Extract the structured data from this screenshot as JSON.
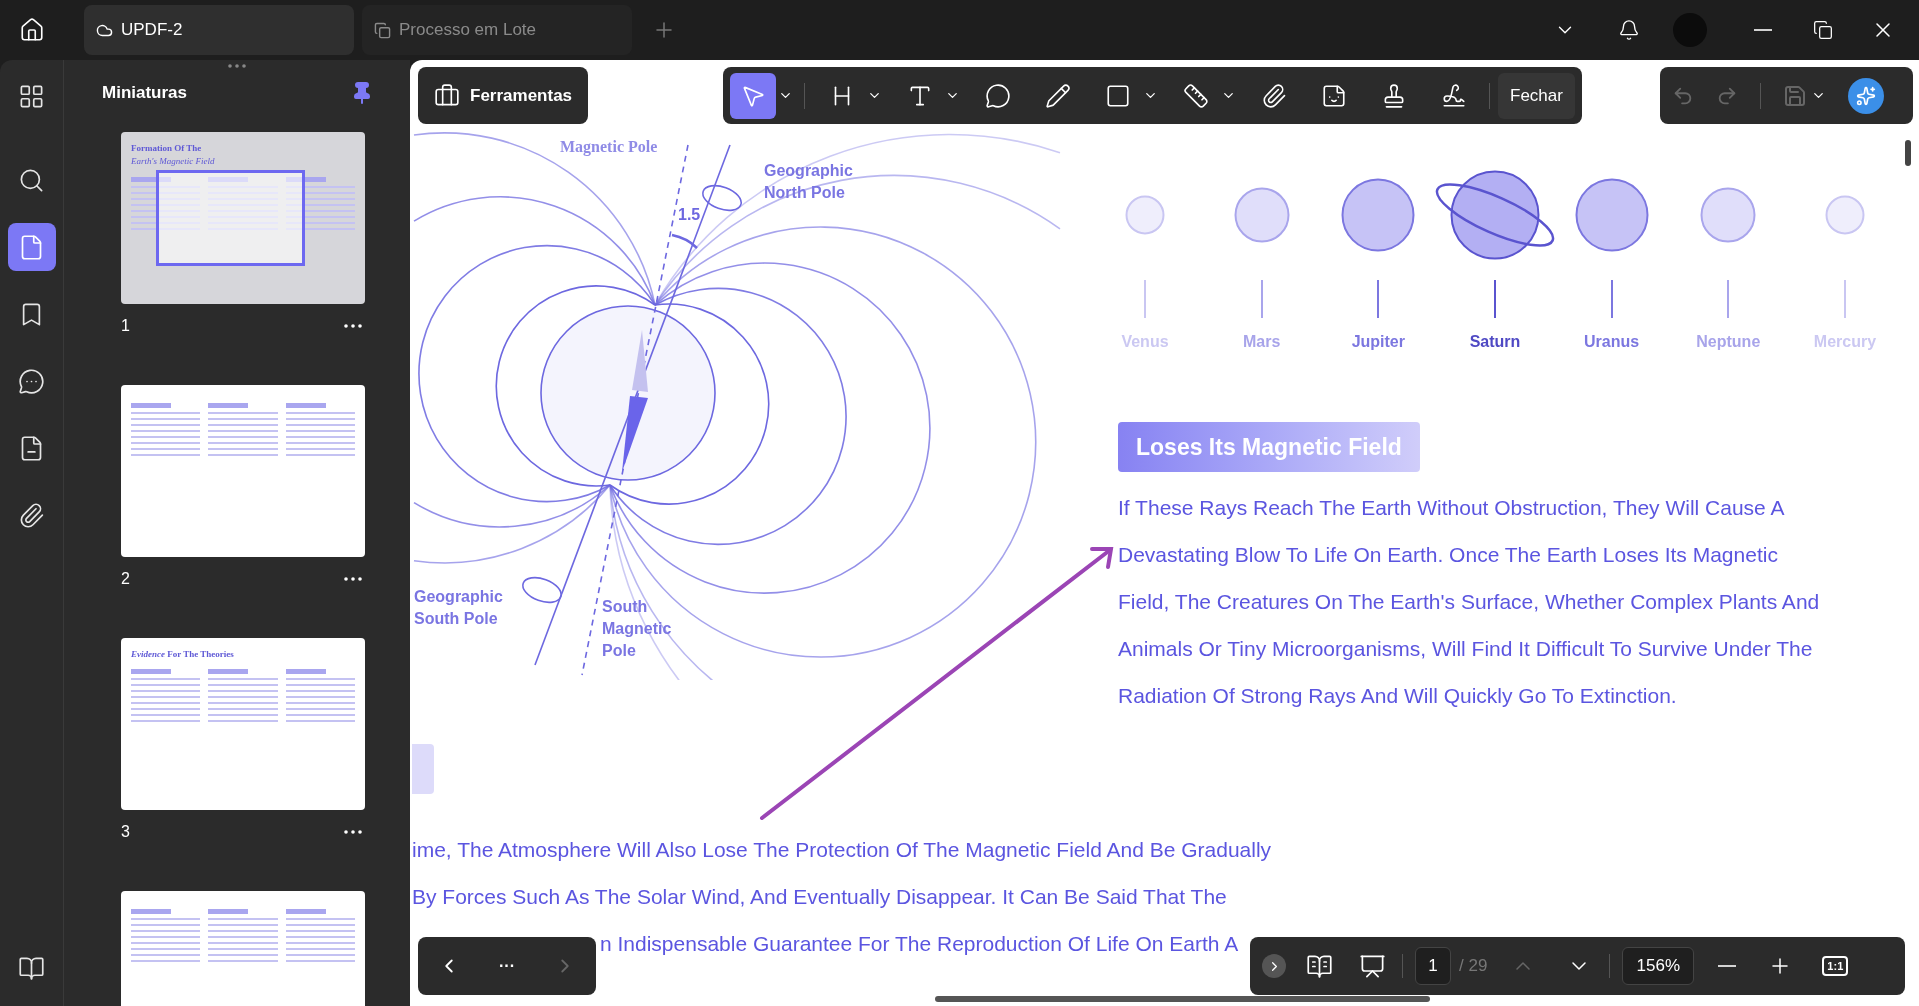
{
  "tabs": [
    {
      "label": "UPDF-2",
      "selected": true
    },
    {
      "label": "Processo em Lote",
      "selected": false
    }
  ],
  "rail": [
    {
      "selected": false
    },
    {
      "selected": false
    },
    {
      "selected": true
    },
    {
      "selected": false
    },
    {
      "selected": false
    },
    {
      "selected": false
    },
    {
      "selected": false
    },
    {
      "selected": false
    }
  ],
  "panel": {
    "title": "Miniaturas",
    "pinned": true
  },
  "thumbnails": [
    {
      "page": "1",
      "selected": true,
      "title": "Formation Of The",
      "subtitle": "Earth's Magnetic Field"
    },
    {
      "page": "2",
      "selected": false
    },
    {
      "page": "3",
      "selected": false,
      "title": "*Evidence* For The Theories"
    },
    {
      "selected": false
    }
  ],
  "tools_button": {
    "label": "Ferramentas"
  },
  "toolbar": {
    "tools": [
      {
        "selected": true,
        "dropdown": true
      },
      {
        "selected": false,
        "dropdown": true
      },
      {
        "selected": false,
        "dropdown": true
      },
      {
        "selected": false,
        "dropdown": false
      },
      {
        "selected": false,
        "dropdown": false
      },
      {
        "selected": false,
        "dropdown": true
      },
      {
        "selected": false,
        "dropdown": true
      },
      {
        "selected": false,
        "dropdown": false
      },
      {
        "selected": false,
        "dropdown": false
      },
      {
        "selected": false,
        "dropdown": false
      },
      {
        "selected": false,
        "dropdown": false
      }
    ],
    "close_label": "Fechar"
  },
  "history": {
    "undo_disabled": true,
    "redo_disabled": true,
    "save_disabled": true
  },
  "diagram": {
    "north_magnetic": "Magnetic Pole",
    "geo_north": "Geographic North Pole",
    "angle": "1.5",
    "geo_south": "Geographic South Pole",
    "south_magnetic": "South Magnetic Pole"
  },
  "planets": [
    {
      "name": "Venus",
      "kind": "small",
      "color": "#efeefc"
    },
    {
      "name": "Mars",
      "kind": "medium",
      "color": "#e0defa"
    },
    {
      "name": "Jupiter",
      "kind": "large",
      "color": "#c6c3f6"
    },
    {
      "name": "Saturn",
      "kind": "ringed",
      "color": "#b3aff3"
    },
    {
      "name": "Uranus",
      "kind": "large",
      "color": "#c6c3f6"
    },
    {
      "name": "Neptune",
      "kind": "medium",
      "color": "#e0defa"
    },
    {
      "name": "Mercury",
      "kind": "small",
      "color": "#efeefc"
    }
  ],
  "section": {
    "heading": "Loses Its Magnetic Field",
    "body_lines": [
      "If These Rays Reach The Earth Without Obstruction, They Will Cause A",
      "Devastating Blow To Life On Earth. Once The Earth Loses Its Magnetic",
      "Field, The Creatures On The Earth's Surface, Whether Complex Plants And",
      "Animals Or Tiny Microorganisms, Will Find It Difficult To Survive Under The",
      "Radiation Of Strong Rays And Will Quickly Go To Extinction."
    ]
  },
  "continued_lines": [
    "ime, The Atmosphere Will Also Lose The Protection Of The Magnetic Field And Be Gradually",
    "By Forces Such As The Solar Wind, And Eventually Disappear. It Can Be Said That The",
    "n Indispensable Guarantee For The Reproduction Of Life On Earth A"
  ],
  "page_nav": {
    "prev_disabled": false,
    "more": "···",
    "next_disabled": true
  },
  "footer": {
    "page": "1",
    "total": "/ 29",
    "up_disabled": true,
    "zoom": "156%",
    "ratio": "1:1"
  }
}
